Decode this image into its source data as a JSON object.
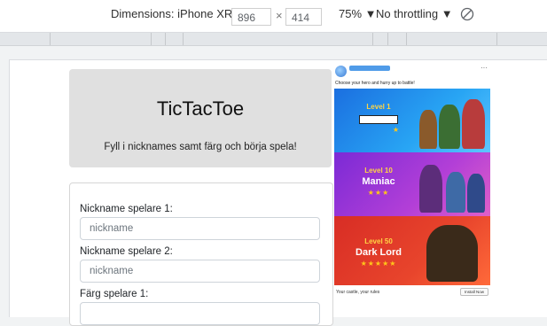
{
  "devtools": {
    "device_label": "Dimensions: iPhone XR ▼",
    "width": "896",
    "separator": "×",
    "height": "414",
    "zoom": "75% ▼",
    "throttling": "No throttling ▼",
    "rotate_icon": "rotate-icon"
  },
  "page": {
    "title": "TicTacToe",
    "subtitle": "Fyll i nicknames samt färg och börja spela!",
    "form": {
      "label_p1": "Nickname spelare 1:",
      "placeholder_p1": "nickname",
      "label_p2": "Nickname spelare 2:",
      "placeholder_p2": "nickname",
      "label_color1": "Färg spelare 1:"
    }
  },
  "ad": {
    "caption": "Choose your hero and hurry up to battle!",
    "more": "···",
    "level1_small": "Level 1",
    "level1_stars": "★",
    "level10_small": "Level 10",
    "level10_big": "Maniac",
    "level10_stars": "★★★",
    "level50_small": "Level 50",
    "level50_big": "Dark Lord",
    "level50_stars": "★★★★★",
    "footer": "Your castle, your rules",
    "install": "Install Now"
  }
}
